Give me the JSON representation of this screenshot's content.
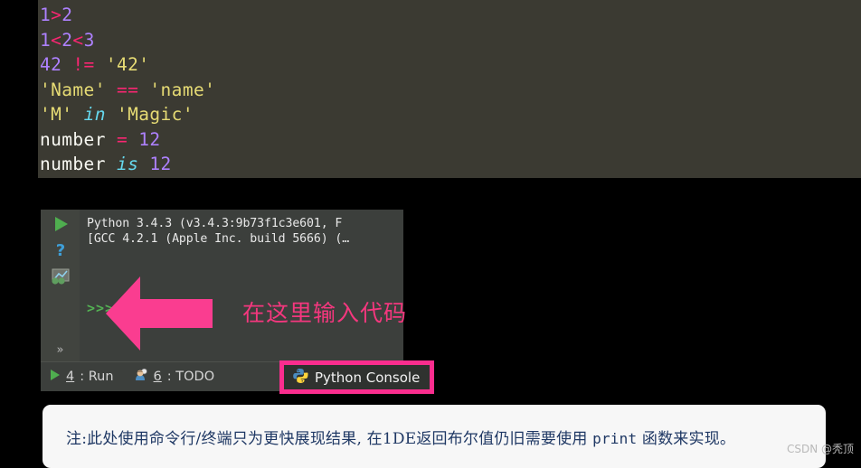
{
  "code_block": {
    "background": "#3b3a32",
    "lines": [
      [
        {
          "t": "1",
          "c": "num"
        },
        {
          "t": ">",
          "c": "op"
        },
        {
          "t": "2",
          "c": "num"
        }
      ],
      [
        {
          "t": "1",
          "c": "num"
        },
        {
          "t": "<",
          "c": "op"
        },
        {
          "t": "2",
          "c": "num"
        },
        {
          "t": "<",
          "c": "op"
        },
        {
          "t": "3",
          "c": "num"
        }
      ],
      [
        {
          "t": "42",
          "c": "num"
        },
        {
          "t": " ",
          "c": "name"
        },
        {
          "t": "!=",
          "c": "op"
        },
        {
          "t": " ",
          "c": "name"
        },
        {
          "t": "'42'",
          "c": "str"
        }
      ],
      [
        {
          "t": "'Name'",
          "c": "str"
        },
        {
          "t": " ",
          "c": "name"
        },
        {
          "t": "==",
          "c": "op"
        },
        {
          "t": " ",
          "c": "name"
        },
        {
          "t": "'name'",
          "c": "str"
        }
      ],
      [
        {
          "t": "'M'",
          "c": "str"
        },
        {
          "t": " ",
          "c": "name"
        },
        {
          "t": "in",
          "c": "kw"
        },
        {
          "t": " ",
          "c": "name"
        },
        {
          "t": "'Magic'",
          "c": "str"
        }
      ],
      [
        {
          "t": "number",
          "c": "name"
        },
        {
          "t": " ",
          "c": "name"
        },
        {
          "t": "=",
          "c": "op"
        },
        {
          "t": " ",
          "c": "name"
        },
        {
          "t": "12",
          "c": "num"
        }
      ],
      [
        {
          "t": "number",
          "c": "name"
        },
        {
          "t": " ",
          "c": "name"
        },
        {
          "t": "is",
          "c": "kw"
        },
        {
          "t": " ",
          "c": "name"
        },
        {
          "t": "12",
          "c": "num"
        }
      ]
    ]
  },
  "console": {
    "background": "#3c3f3c",
    "gutter_background": "#41443f",
    "icons": {
      "run": "play-icon",
      "help": "question-mark-icon",
      "variables": "variables-chart-icon",
      "more": "chevrons-right-icon"
    },
    "more_label": "»",
    "help_label": "?",
    "output_lines": [
      "Python 3.4.3 (v3.4.3:9b73f1c3e601, F",
      "[GCC 4.2.1 (Apple Inc. build 5666) (…"
    ],
    "prompt": ">>>",
    "prompt_color": "#53b153",
    "annotation": {
      "text": "在这里输入代码",
      "color": "#f4377e",
      "arrow_color": "#fa3d90",
      "arrow_direction": "left"
    },
    "tabs": [
      {
        "icon": "play-icon",
        "number": "4",
        "label": ": Run"
      },
      {
        "icon": "todo-person-icon",
        "number": "6",
        "label": ": TODO"
      }
    ],
    "active_tab": {
      "icon": "python-logo-icon",
      "label": "Python Console",
      "highlight_color": "#fa2d8e"
    }
  },
  "note": {
    "prefix": "注:此处使用命令行/终端只为更快展现结果, 在1DE返回布尔值仍旧需要使用 ",
    "code": "print",
    "suffix": " 函数来实现。",
    "background": "#f7f7f7",
    "text_color": "#1f3864"
  },
  "watermark": "CSDN @秃顶"
}
